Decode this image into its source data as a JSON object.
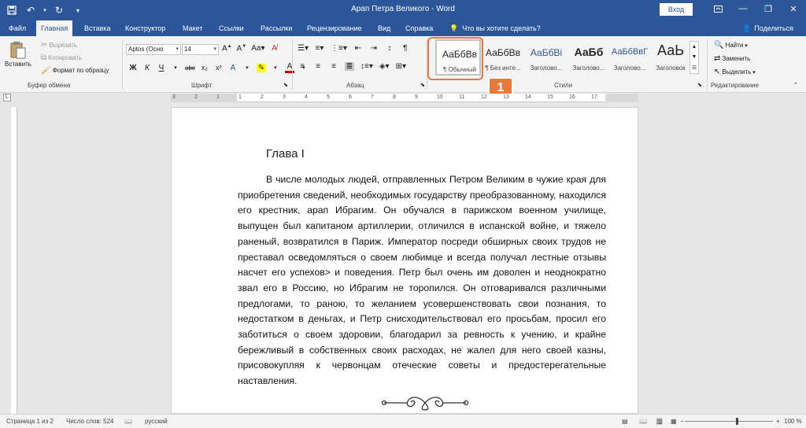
{
  "titlebar": {
    "title": "Арап Петра Великого  -  Word",
    "signin": "Вход"
  },
  "tabs": [
    {
      "label": "Файл",
      "active": false
    },
    {
      "label": "Главная",
      "active": true
    },
    {
      "label": "Вставка",
      "active": false
    },
    {
      "label": "Конструктор",
      "active": false
    },
    {
      "label": "Макет",
      "active": false
    },
    {
      "label": "Ссылки",
      "active": false
    },
    {
      "label": "Рассылки",
      "active": false
    },
    {
      "label": "Рецензирование",
      "active": false
    },
    {
      "label": "Вид",
      "active": false
    },
    {
      "label": "Справка",
      "active": false
    }
  ],
  "tellme": "Что вы хотите сделать?",
  "share": "Поделиться",
  "clipboard": {
    "paste": "Вставить",
    "cut": "Вырезать",
    "copy": "Копировать",
    "format_painter": "Формат по образцу",
    "label": "Буфер обмена"
  },
  "font": {
    "name": "Aptos (Осно",
    "size": "14",
    "label": "Шрифт",
    "bold": "Ж",
    "italic": "К",
    "underline": "Ч",
    "strike": "abc",
    "subscript": "x₂",
    "superscript": "x²"
  },
  "paragraph": {
    "label": "Абзац"
  },
  "styles": {
    "label": "Стили",
    "items": [
      {
        "preview": "АаБбВв",
        "name": "¶ Обычный"
      },
      {
        "preview": "АаБбВв",
        "name": "¶ Без инте..."
      },
      {
        "preview": "АаБбВі",
        "name": "Заголово..."
      },
      {
        "preview": "АаБб",
        "name": "Заголово..."
      },
      {
        "preview": "АаБбВвГ",
        "name": "Заголово..."
      },
      {
        "preview": "АаЬ",
        "name": "Заголовок"
      }
    ]
  },
  "editing": {
    "label": "Редактирование",
    "find": "Найти",
    "replace": "Заменить",
    "select": "Выделить"
  },
  "callout": "1",
  "ruler_numbers": [
    "3",
    "2",
    "1",
    "1",
    "2",
    "3",
    "4",
    "5",
    "6",
    "7",
    "8",
    "9",
    "10",
    "11",
    "12",
    "13",
    "14",
    "15",
    "16",
    "17"
  ],
  "document": {
    "heading": "Глава I",
    "paragraph": "В числе молодых людей, отправленных Петром Великим в чужие края для приобретения сведений, необходимых государству преобразованному, находился его крестник, арап Ибрагим. Он обучался в парижском военном училище, выпущен был капитаном артиллерии, отличился в испанской войне, и тяжело раненый, возвратился в Париж. Император посреди обширных своих трудов не преставал осведомляться о своем любимце и всегда получал лестные отзывы насчет его успехов> и поведения. Петр был очень им доволен и неоднократно звал его в Россию, но Ибрагим не торопился. Он отговаривался различными предлогами, то раною, то желанием усовершенствовать свои познания, то недостатком в деньгах, и Петр снисходительствовал его просьбам, просил его заботиться о своем здоровии, благодарил за ревность к учению, и крайне бережливый в собственных своих расходах, не жалел для него своей казны, присовокупляя к червонцам отеческие советы и предостерегательные наставления."
  },
  "status": {
    "page": "Страница 1 из 2",
    "words": "Число слов: 524",
    "lang": "русский",
    "zoom": "100 %"
  },
  "colors": {
    "brand": "#2b579a",
    "callout": "#e8793a"
  }
}
